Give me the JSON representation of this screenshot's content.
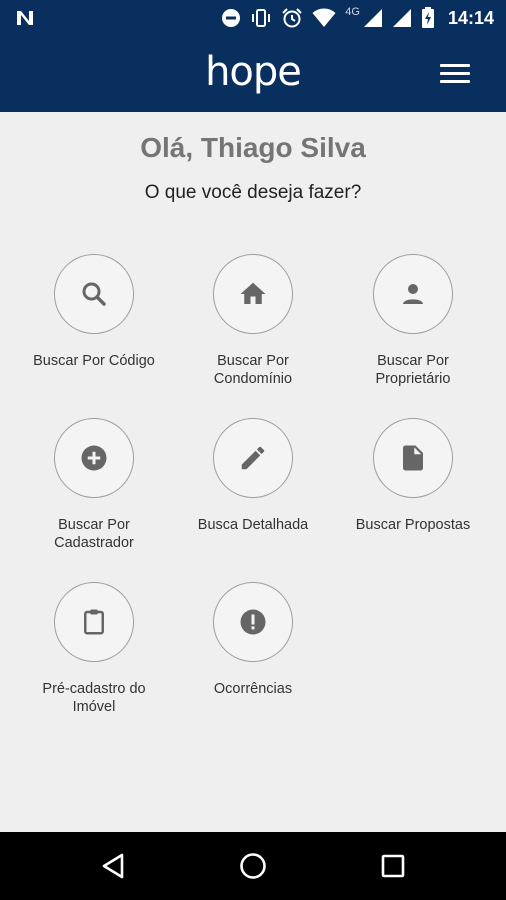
{
  "status_bar": {
    "time": "14:14",
    "network": "4G",
    "icons": [
      "n-notification-icon",
      "do-not-disturb-icon",
      "vibrate-icon",
      "alarm-icon",
      "wifi-icon",
      "signal-icon",
      "battery-icon"
    ]
  },
  "app_bar": {
    "brand": "hope",
    "menu_icon": "hamburger-menu-icon"
  },
  "main": {
    "greeting": "Olá, Thiago Silva",
    "question": "O que você deseja fazer?",
    "actions": [
      {
        "label_line1": "Buscar Por Código",
        "label_line2": "",
        "icon": "search-icon"
      },
      {
        "label_line1": "Buscar Por",
        "label_line2": "Condomínio",
        "icon": "home-icon"
      },
      {
        "label_line1": "Buscar Por",
        "label_line2": "Proprietário",
        "icon": "person-icon"
      },
      {
        "label_line1": "Buscar Por",
        "label_line2": "Cadastrador",
        "icon": "add-circle-icon"
      },
      {
        "label_line1": "Busca Detalhada",
        "label_line2": "",
        "icon": "pencil-icon"
      },
      {
        "label_line1": "Buscar Propostas",
        "label_line2": "",
        "icon": "document-icon"
      },
      {
        "label_line1": "Pré-cadastro do",
        "label_line2": "Imóvel",
        "icon": "clipboard-icon"
      },
      {
        "label_line1": "Ocorrências",
        "label_line2": "",
        "icon": "alert-icon"
      }
    ]
  },
  "nav_bar": {
    "buttons": [
      "back-icon",
      "home-circle-icon",
      "recents-icon"
    ]
  },
  "colors": {
    "primary": "#082f5e",
    "background": "#efefef",
    "icon": "#666666",
    "nav": "#000000"
  }
}
